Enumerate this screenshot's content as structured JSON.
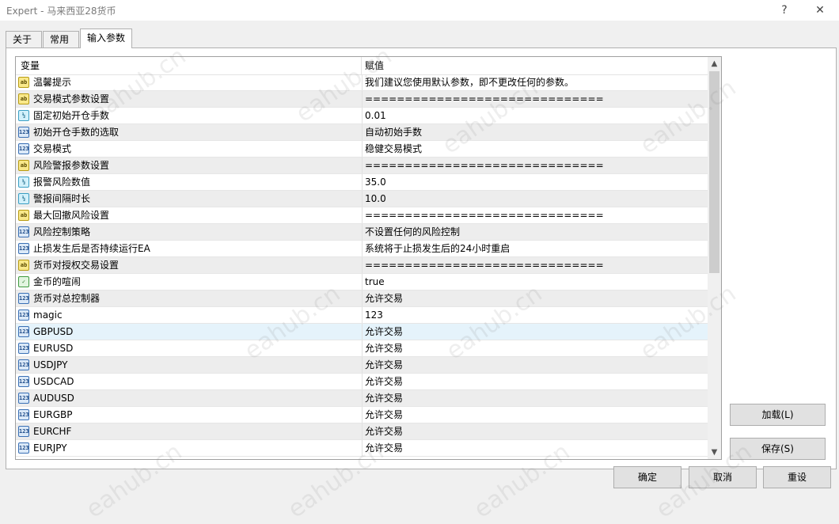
{
  "window": {
    "title": "Expert - 马来西亚28货币",
    "help_label": "?",
    "close_label": "✕"
  },
  "tabs": [
    {
      "label": "关于",
      "active": false
    },
    {
      "label": "常用",
      "active": false
    },
    {
      "label": "输入参数",
      "active": true
    }
  ],
  "grid": {
    "columns": [
      "变量",
      "赋值"
    ],
    "rows": [
      {
        "icon": "ab",
        "name": "温馨提示",
        "value": "我们建议您使用默认参数，即不更改任何的参数。"
      },
      {
        "icon": "ab",
        "name": "交易模式参数设置",
        "value": "=============================="
      },
      {
        "icon": "v2",
        "name": "固定初始开仓手数",
        "value": "0.01"
      },
      {
        "icon": "123",
        "name": "初始开仓手数的选取",
        "value": "自动初始手数"
      },
      {
        "icon": "123",
        "name": "交易模式",
        "value": "稳健交易模式"
      },
      {
        "icon": "ab",
        "name": "风险警报参数设置",
        "value": "=============================="
      },
      {
        "icon": "v2",
        "name": "报警风险数值",
        "value": "35.0"
      },
      {
        "icon": "v2",
        "name": "警报间隔时长",
        "value": "10.0"
      },
      {
        "icon": "ab",
        "name": "最大回撤风险设置",
        "value": "=============================="
      },
      {
        "icon": "123",
        "name": "风险控制策略",
        "value": "不设置任何的风险控制"
      },
      {
        "icon": "123",
        "name": "止损发生后是否持续运行EA",
        "value": "系统将于止损发生后的24小时重启"
      },
      {
        "icon": "ab",
        "name": "货币对授权交易设置",
        "value": "=============================="
      },
      {
        "icon": "bool",
        "name": "金币的喧闹",
        "value": "true"
      },
      {
        "icon": "123",
        "name": "货币对总控制器",
        "value": "允许交易"
      },
      {
        "icon": "123",
        "name": "magic",
        "value": "123"
      },
      {
        "icon": "123",
        "name": "GBPUSD",
        "value": "允许交易",
        "selected": true
      },
      {
        "icon": "123",
        "name": "EURUSD",
        "value": "允许交易"
      },
      {
        "icon": "123",
        "name": "USDJPY",
        "value": "允许交易"
      },
      {
        "icon": "123",
        "name": "USDCAD",
        "value": "允许交易"
      },
      {
        "icon": "123",
        "name": "AUDUSD",
        "value": "允许交易"
      },
      {
        "icon": "123",
        "name": "EURGBP",
        "value": "允许交易"
      },
      {
        "icon": "123",
        "name": "EURCHF",
        "value": "允许交易"
      },
      {
        "icon": "123",
        "name": "EURJPY",
        "value": "允许交易"
      }
    ]
  },
  "buttons": {
    "load": "加载(L)",
    "save": "保存(S)",
    "ok": "确定",
    "cancel": "取消",
    "reset": "重设"
  },
  "watermark": "eahub.cn",
  "icon_labels": {
    "ab": "ab",
    "v2": "½",
    "123": "123",
    "bool": "✓"
  }
}
